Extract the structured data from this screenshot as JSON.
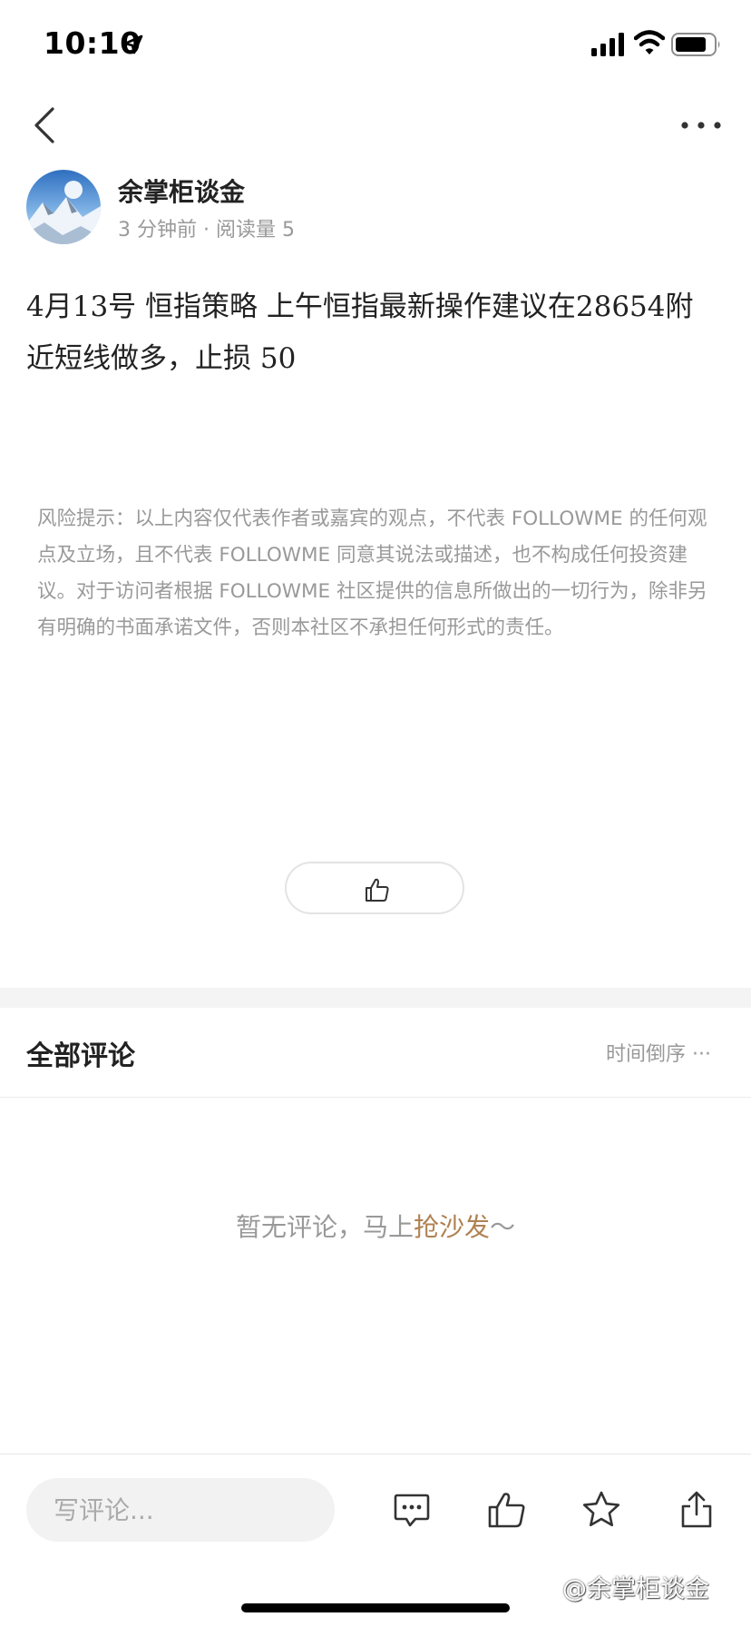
{
  "status_bar": {
    "time": "10:10"
  },
  "author": {
    "name": "余掌柜谈金",
    "meta": "3 分钟前 · 阅读量 5"
  },
  "post": {
    "content": "4月13号 恒指策略  上午恒指最新操作建议在28654附近短线做多，止损 50",
    "disclaimer": "风险提示：以上内容仅代表作者或嘉宾的观点，不代表 FOLLOWME 的任何观点及立场，且不代表 FOLLOWME 同意其说法或描述，也不构成任何投资建议。对于访问者根据 FOLLOWME 社区提供的信息所做出的一切行为，除非另有明确的书面承诺文件，否则本社区不承担任何形式的责任。"
  },
  "comments": {
    "title": "全部评论",
    "sort_label": "时间倒序",
    "sort_dots": "···",
    "empty_text": "暂无评论，马上",
    "empty_link": "抢沙发",
    "empty_suffix": "～"
  },
  "bottom_bar": {
    "comment_placeholder": "写评论..."
  },
  "watermark": "@余掌柜谈金",
  "icons": {
    "back": "back-arrow-icon",
    "more": "more-dots-icon",
    "like": "thumbs-up-icon",
    "comment": "comment-bubble-icon",
    "favorite": "star-icon",
    "share": "share-icon"
  },
  "colors": {
    "accent_link": "#b08252",
    "muted_text": "#999999",
    "section_gap": "#f4f4f4"
  }
}
